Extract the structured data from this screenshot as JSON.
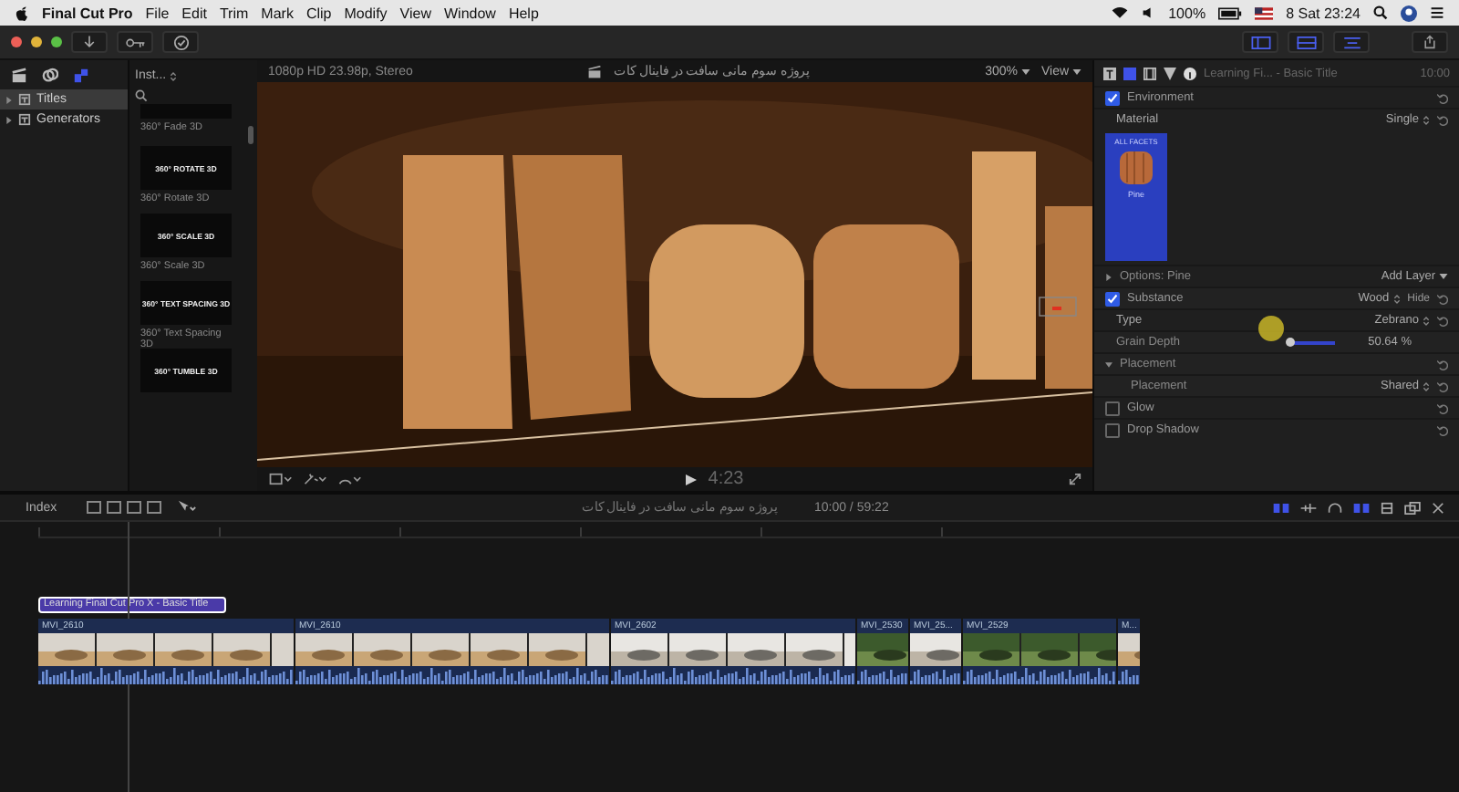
{
  "menubar": {
    "app": "Final Cut Pro",
    "menus": [
      "File",
      "Edit",
      "Trim",
      "Mark",
      "Clip",
      "Modify",
      "View",
      "Window",
      "Help"
    ],
    "battery": "100%",
    "clock": "8 Sat 23:24"
  },
  "library": {
    "items": [
      {
        "label": "Titles",
        "selected": true
      },
      {
        "label": "Generators",
        "selected": false
      }
    ]
  },
  "browser": {
    "filter": "Inst...",
    "thumbnails": [
      {
        "label": "360° Fade 3D"
      },
      {
        "preview": "360° ROTATE 3D",
        "label": "360° Rotate 3D"
      },
      {
        "preview": "360° SCALE 3D",
        "label": "360° Scale 3D"
      },
      {
        "preview": "360° TEXT SPACING 3D",
        "label": "360° Text Spacing 3D"
      },
      {
        "preview": "360° TUMBLE 3D"
      }
    ]
  },
  "viewer": {
    "format": "1080p HD 23.98p, Stereo",
    "title": "پروژه سوم مانی سافت در فاینال کات",
    "zoom": "300%",
    "view": "View",
    "timecode": "4:23"
  },
  "inspector": {
    "title": "Learning Fi... - Basic Title",
    "duration": "10:00",
    "rows": [
      {
        "kind": "section",
        "label": "Environment",
        "checked": true
      },
      {
        "kind": "param",
        "label": "Material",
        "value": "Single"
      },
      {
        "kind": "swatch",
        "caption": "ALL FACETS",
        "name": "Pine"
      },
      {
        "kind": "options",
        "label": "Options: Pine",
        "action": "Add Layer"
      },
      {
        "kind": "section",
        "label": "Substance",
        "checked": true,
        "value": "Wood",
        "action": "Hide"
      },
      {
        "kind": "param",
        "label": "Type",
        "value": "Zebrano"
      },
      {
        "kind": "slider",
        "label": "Grain Depth",
        "level": 0.05,
        "reading": "50.64 %"
      },
      {
        "kind": "group",
        "label": "Placement",
        "expanded": true,
        "children": [
          {
            "kind": "param",
            "label": "Placement",
            "value": "Shared"
          }
        ]
      },
      {
        "kind": "section",
        "label": "Glow",
        "checked": false
      },
      {
        "kind": "section",
        "label": "Drop Shadow",
        "checked": false
      }
    ]
  },
  "timeline": {
    "index": "Index",
    "project": "پروژه سوم مانی سافت در فاینال کات",
    "timecode": "10:00 / 59:22",
    "title_clip": {
      "label": "Learning Final Cut Pro X - Basic Title",
      "selected": true
    },
    "clips": [
      {
        "name": "MVI_2610",
        "kind": "desert"
      },
      {
        "name": "MVI_2610",
        "kind": "desert"
      },
      {
        "name": "MVI_2602",
        "kind": "shore"
      },
      {
        "name": "MVI_2530",
        "kind": "forest"
      },
      {
        "name": "MVI_25...",
        "kind": "shore"
      },
      {
        "name": "MVI_2529",
        "kind": "forest"
      },
      {
        "name": "M...",
        "kind": "desert"
      }
    ]
  }
}
